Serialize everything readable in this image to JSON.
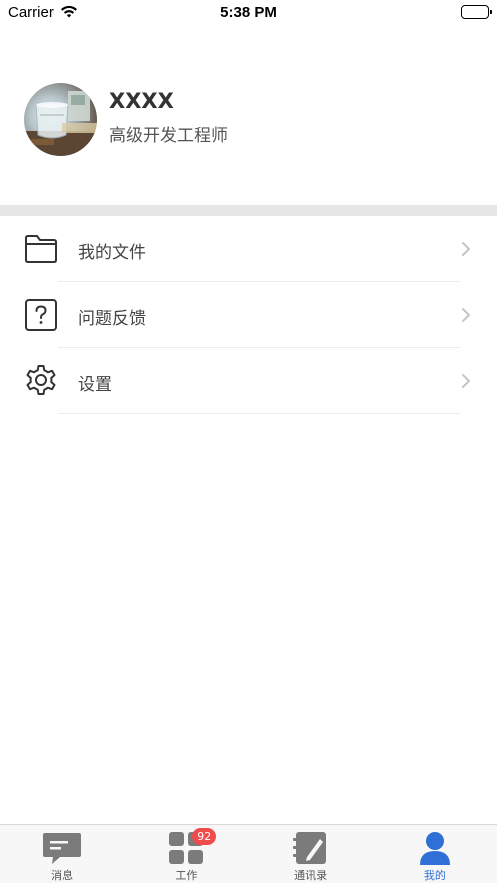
{
  "status_bar": {
    "carrier": "Carrier",
    "time": "5:38 PM"
  },
  "profile": {
    "name": "XXXX",
    "title": "高级开发工程师"
  },
  "menu": [
    {
      "label": "我的文件",
      "icon": "folder-icon"
    },
    {
      "label": "问题反馈",
      "icon": "question-icon"
    },
    {
      "label": "设置",
      "icon": "gear-icon"
    }
  ],
  "tabs": [
    {
      "label": "消息",
      "icon": "message-icon",
      "active": false
    },
    {
      "label": "工作",
      "icon": "work-grid-icon",
      "active": false,
      "badge": "92"
    },
    {
      "label": "通讯录",
      "icon": "contacts-icon",
      "active": false
    },
    {
      "label": "我的",
      "icon": "profile-icon",
      "active": true
    }
  ],
  "colors": {
    "accent": "#2f6fd6",
    "badge": "#f04b4b",
    "tab_icon": "#7b7b7b",
    "separator": "#e6e6e6"
  }
}
